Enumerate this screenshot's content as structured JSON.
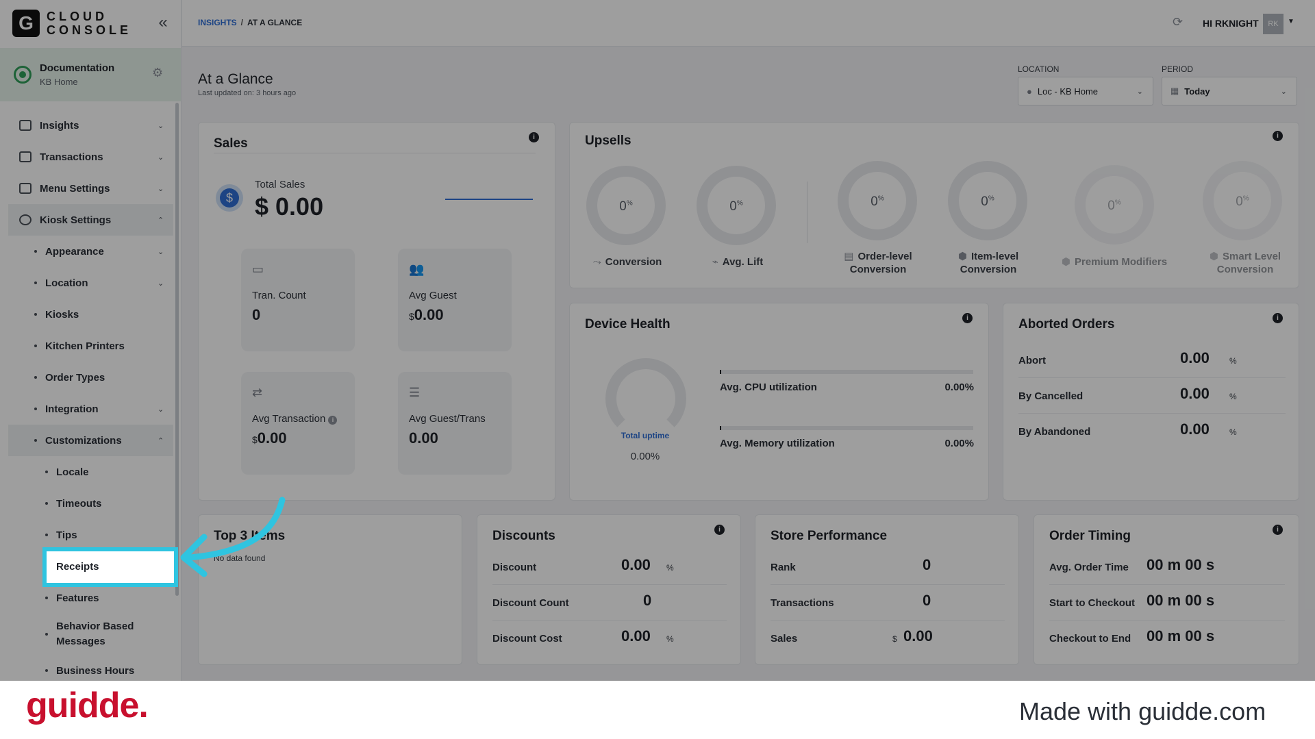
{
  "logo": {
    "letter": "G",
    "line1": "CLOUD",
    "line2": "CONSOLE"
  },
  "org": {
    "name": "Documentation",
    "sub": "KB Home"
  },
  "nav": {
    "insights": "Insights",
    "transactions": "Transactions",
    "menu_settings": "Menu Settings",
    "kiosk_settings": "Kiosk Settings",
    "appearance": "Appearance",
    "location": "Location",
    "kiosks": "Kiosks",
    "kitchen_printers": "Kitchen Printers",
    "order_types": "Order Types",
    "integration": "Integration",
    "customizations": "Customizations",
    "locale": "Locale",
    "timeouts": "Timeouts",
    "tips": "Tips",
    "receipts": "Receipts",
    "features": "Features",
    "behavior_based_messages": "Behavior Based Messages",
    "business_hours": "Business Hours"
  },
  "breadcrumb": {
    "root": "INSIGHTS",
    "sep": "/",
    "current": "AT A GLANCE"
  },
  "user": {
    "greeting": "HI RKNIGHT",
    "initials": "RK"
  },
  "page": {
    "title": "At a Glance",
    "subtitle": "Last updated on: 3 hours ago"
  },
  "filters": {
    "location_label": "LOCATION",
    "location_value": "Loc - KB Home",
    "period_label": "PERIOD",
    "period_value": "Today"
  },
  "sales": {
    "title": "Sales",
    "total_label": "Total Sales",
    "total_value": "$ 0.00",
    "tran_count_label": "Tran. Count",
    "tran_count_value": "0",
    "avg_guest_label": "Avg Guest",
    "avg_guest_currency": "$",
    "avg_guest_value": "0.00",
    "avg_transaction_label": "Avg Transaction",
    "avg_transaction_currency": "$",
    "avg_transaction_value": "0.00",
    "avg_guest_trans_label": "Avg Guest/Trans",
    "avg_guest_trans_value": "0.00"
  },
  "upsells": {
    "title": "Upsells",
    "items": [
      {
        "value": "0",
        "unit": "%",
        "label": "Conversion"
      },
      {
        "value": "0",
        "unit": "%",
        "label": "Avg. Lift"
      },
      {
        "value": "0",
        "unit": "%",
        "label1": "Order-level",
        "label2": "Conversion"
      },
      {
        "value": "0",
        "unit": "%",
        "label1": "Item-level",
        "label2": "Conversion"
      },
      {
        "value": "0",
        "unit": "%",
        "label": "Premium Modifiers"
      },
      {
        "value": "0",
        "unit": "%",
        "label1": "Smart Level",
        "label2": "Conversion"
      }
    ]
  },
  "device_health": {
    "title": "Device Health",
    "uptime_label": "Total uptime",
    "uptime_value": "0.00%",
    "cpu_label": "Avg. CPU utilization",
    "cpu_value": "0.00%",
    "mem_label": "Avg. Memory utilization",
    "mem_value": "0.00%"
  },
  "aborted": {
    "title": "Aborted Orders",
    "rows": [
      {
        "label": "Abort",
        "value": "0.00",
        "unit": "%"
      },
      {
        "label": "By Cancelled",
        "value": "0.00",
        "unit": "%"
      },
      {
        "label": "By Abandoned",
        "value": "0.00",
        "unit": "%"
      }
    ]
  },
  "top_items": {
    "title": "Top 3 Items",
    "empty": "No data found"
  },
  "discounts": {
    "title": "Discounts",
    "rows": [
      {
        "label": "Discount",
        "value": "0.00",
        "unit": "%"
      },
      {
        "label": "Discount Count",
        "value": "0",
        "unit": ""
      },
      {
        "label": "Discount Cost",
        "value": "0.00",
        "unit": "%"
      }
    ]
  },
  "store_performance": {
    "title": "Store Performance",
    "rows": [
      {
        "label": "Rank",
        "value": "0",
        "unit": ""
      },
      {
        "label": "Transactions",
        "value": "0",
        "unit": ""
      },
      {
        "label": "Sales",
        "value": "0.00",
        "unit": "$"
      }
    ]
  },
  "order_timing": {
    "title": "Order Timing",
    "rows": [
      {
        "label": "Avg. Order Time",
        "value": "00 m 00 s"
      },
      {
        "label": "Start to Checkout",
        "value": "00 m 00 s"
      },
      {
        "label": "Checkout to End",
        "value": "00 m 00 s"
      }
    ]
  },
  "footer": {
    "brand": "guidde.",
    "made_with": "Made with guidde.com"
  },
  "colors": {
    "accent": "#2f6fd6",
    "highlight": "#2fc4e0",
    "brand": "#c8102e"
  }
}
